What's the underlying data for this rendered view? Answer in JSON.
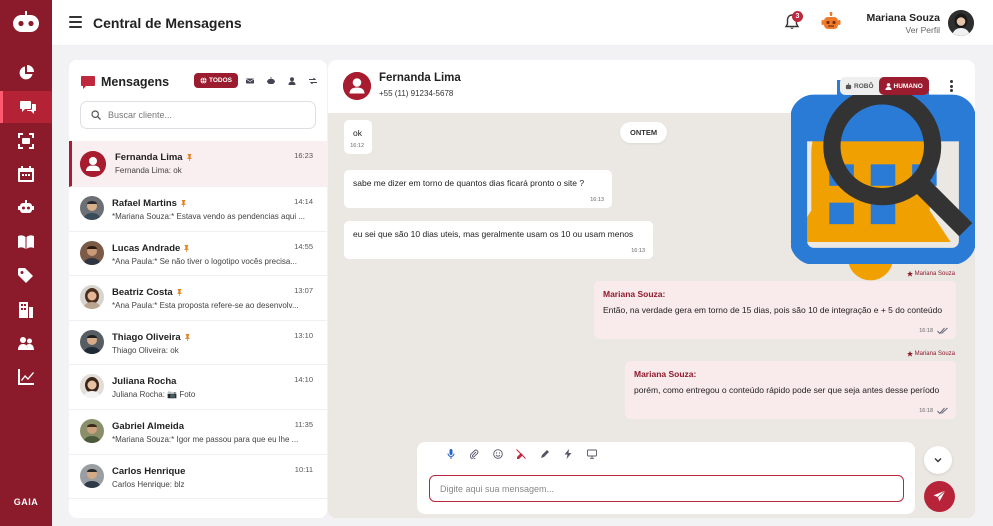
{
  "app": {
    "title": "Central de Mensagens",
    "brand_label": "GAIA"
  },
  "nav": {
    "items": [
      {
        "icon": "pie-chart-icon",
        "active": false
      },
      {
        "icon": "chat-bubbles-icon",
        "active": true
      },
      {
        "icon": "scan-icon",
        "active": false
      },
      {
        "icon": "calendar-icon",
        "active": false
      },
      {
        "icon": "robot-icon",
        "active": false
      },
      {
        "icon": "book-icon",
        "active": false
      },
      {
        "icon": "tag-icon",
        "active": false
      },
      {
        "icon": "building-icon",
        "active": false
      },
      {
        "icon": "users-icon",
        "active": false
      },
      {
        "icon": "line-chart-icon",
        "active": false
      }
    ]
  },
  "topbar": {
    "notification_count": "3",
    "user_name": "Mariana Souza",
    "user_link": "Ver Perfil"
  },
  "list": {
    "title": "Mensagens",
    "filter_all": "TODOS",
    "search_placeholder": "Buscar cliente...",
    "conversations": [
      {
        "name": "Fernanda Lima",
        "pinned": true,
        "time": "16:23",
        "preview": "Fernanda Lima: ok",
        "active": true
      },
      {
        "name": "Rafael Martins",
        "pinned": true,
        "time": "14:14",
        "preview": "*Mariana Souza:* Estava vendo as pendencias aqui ...",
        "active": false
      },
      {
        "name": "Lucas Andrade",
        "pinned": true,
        "time": "14:55",
        "preview": "*Ana Paula:* Se não tiver o logotipo vocês precisa...",
        "active": false
      },
      {
        "name": "Beatriz Costa",
        "pinned": true,
        "time": "13:07",
        "preview": "*Ana Paula:* Esta proposta refere-se ao desenvolv...",
        "active": false
      },
      {
        "name": "Thiago Oliveira",
        "pinned": true,
        "time": "13:10",
        "preview": "Thiago Oliveira: ok",
        "active": false
      },
      {
        "name": "Juliana Rocha",
        "pinned": false,
        "time": "14:10",
        "preview": "Juliana Rocha: 📷 Foto",
        "active": false
      },
      {
        "name": "Gabriel Almeida",
        "pinned": false,
        "time": "11:35",
        "preview": "*Mariana Souza:* Igor me passou para que eu lhe ...",
        "active": false
      },
      {
        "name": "Carlos Henrique",
        "pinned": false,
        "time": "10:11",
        "preview": "Carlos Henrique: blz",
        "active": false
      }
    ]
  },
  "chat": {
    "contact_name": "Fernanda Lima",
    "contact_phone": "+55 (11) 91234-5678",
    "mode_robot": "ROBÔ",
    "mode_human": "HUMANO",
    "day_label": "ONTEM",
    "messages": [
      {
        "text": "ok",
        "time": "16:12"
      },
      {
        "text": "sabe me dizer em torno de quantos dias ficará pronto o site ?",
        "time": "16:13"
      },
      {
        "text": "eu sei que são 10 dias uteis, mas geralmente usam os 10 ou usam menos",
        "time": "16:13"
      },
      {
        "sender_tag": "Mariana Souza",
        "from": "Mariana Souza:",
        "text": "Então, na verdade gera em torno de 15 dias, pois são 10 de integração e + 5 do conteúdo",
        "time": "16:18"
      },
      {
        "sender_tag": "Mariana Souza",
        "from": "Mariana Souza:",
        "text": "porém, como entregou o conteúdo rápido pode ser que seja antes desse período",
        "time": "16:18"
      }
    ],
    "input_placeholder": "Digite aqui sua mensagem..."
  },
  "colors": {
    "brand": "#8b1a2b",
    "accent": "#b7243a",
    "bubble_out": "#f9eaec",
    "chat_bg": "#ebe7e2"
  }
}
